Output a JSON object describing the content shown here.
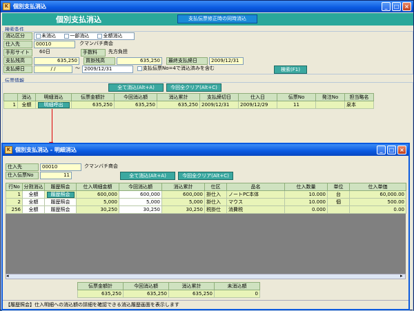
{
  "main": {
    "title": "個別支払消込",
    "header": "個別支払消込",
    "header_btn": "支払伝票修正時の同時消込",
    "search_label": "検索条件",
    "kubun_label": "消込区分",
    "kubun_opts": [
      "未消込",
      "一部消込",
      "全額消込"
    ],
    "shiire_label": "仕入先",
    "shiire_code": "00010",
    "shiire_name": "クマンバチ商会",
    "tegata_label": "手形サイト",
    "tegata_val": "60日",
    "tesuryo_label": "手数料",
    "tesuryo_val": "先方負担",
    "zandaka_label": "支払残高",
    "zandaka_val": "635,250",
    "kaikake_label": "買掛残高",
    "kaikake_val": "635,250",
    "saishu_label": "最終支払締日",
    "saishu_val": "2009/12/31",
    "shimebi_label": "支払締日",
    "shimebi_from": "/  /",
    "tilde": "〜",
    "shimebi_to": "2009/12/31",
    "shimebi_chk": "支払伝票No=4で消込済みを含む",
    "search_btn": "検索(F1)",
    "denpyo_label": "伝票情報",
    "all_btn": "全て消込(Alt+A)",
    "clear_btn": "今回全クリア(Alt+C)",
    "cols": [
      "",
      "消込",
      "明細消込",
      "伝票金額計",
      "今回消込額",
      "消込累計",
      "支払締切日",
      "仕入日",
      "伝票No",
      "発注No",
      "担当略名"
    ],
    "row": {
      "no": "1",
      "kubun": "全額",
      "detail_btn": "明細呼出",
      "amount": "635,250",
      "now": "635,250",
      "total": "635,250",
      "shime": "2009/12/31",
      "date": "2009/12/29",
      "denpyo": "11",
      "hachu": "",
      "tanto": "泉本"
    }
  },
  "sub": {
    "title": "個別支払消込 - 明細消込",
    "shiire_label": "仕入先",
    "shiire_code": "00010",
    "shiire_name": "クマンバチ商会",
    "denpyo_label": "仕入伝票No",
    "denpyo_val": "11",
    "all_btn": "全て消込(Alt+A)",
    "clear_btn": "今回全クリア(Alt+C)",
    "cols": [
      "行No",
      "分割消込",
      "履歴照会",
      "仕入明細金額",
      "今回消込額",
      "消込累計",
      "仕区",
      "品名",
      "仕入数量",
      "単位",
      "仕入単価"
    ],
    "rows": [
      {
        "no": "1",
        "kubun": "全額",
        "btn": "履歴照会",
        "amount": "600,000",
        "now": "600,000",
        "total": "600,000",
        "shiku": "掛仕入",
        "name": "ノートPC本体",
        "qty": "10.000",
        "unit": "台",
        "price": "60,000.00"
      },
      {
        "no": "2",
        "kubun": "全額",
        "btn": "履歴照会",
        "amount": "5,000",
        "now": "5,000",
        "total": "5,000",
        "shiku": "掛仕入",
        "name": "マウス",
        "qty": "10.000",
        "unit": "個",
        "price": "500.00"
      },
      {
        "no": "256",
        "kubun": "全額",
        "btn": "履歴照会",
        "amount": "30,250",
        "now": "30,250",
        "total": "30,250",
        "shiku": "税掛仕",
        "name": "消費税",
        "qty": "0.000",
        "unit": "",
        "price": "0.00"
      }
    ],
    "sum_cols": [
      "伝票金額計",
      "今回消込額",
      "消込累計",
      "未消込額"
    ],
    "sum_vals": [
      "635,250",
      "635,250",
      "635,250",
      "0"
    ],
    "status": "【履歴照会】仕入明細への消込額の詳細を確認できる消込履歴画面を表示します"
  },
  "colors": {
    "accent": "#3ba8a0",
    "label": "#cfe2c0",
    "row": "#e8f4b8",
    "titlebar": "#0a5ae0"
  }
}
